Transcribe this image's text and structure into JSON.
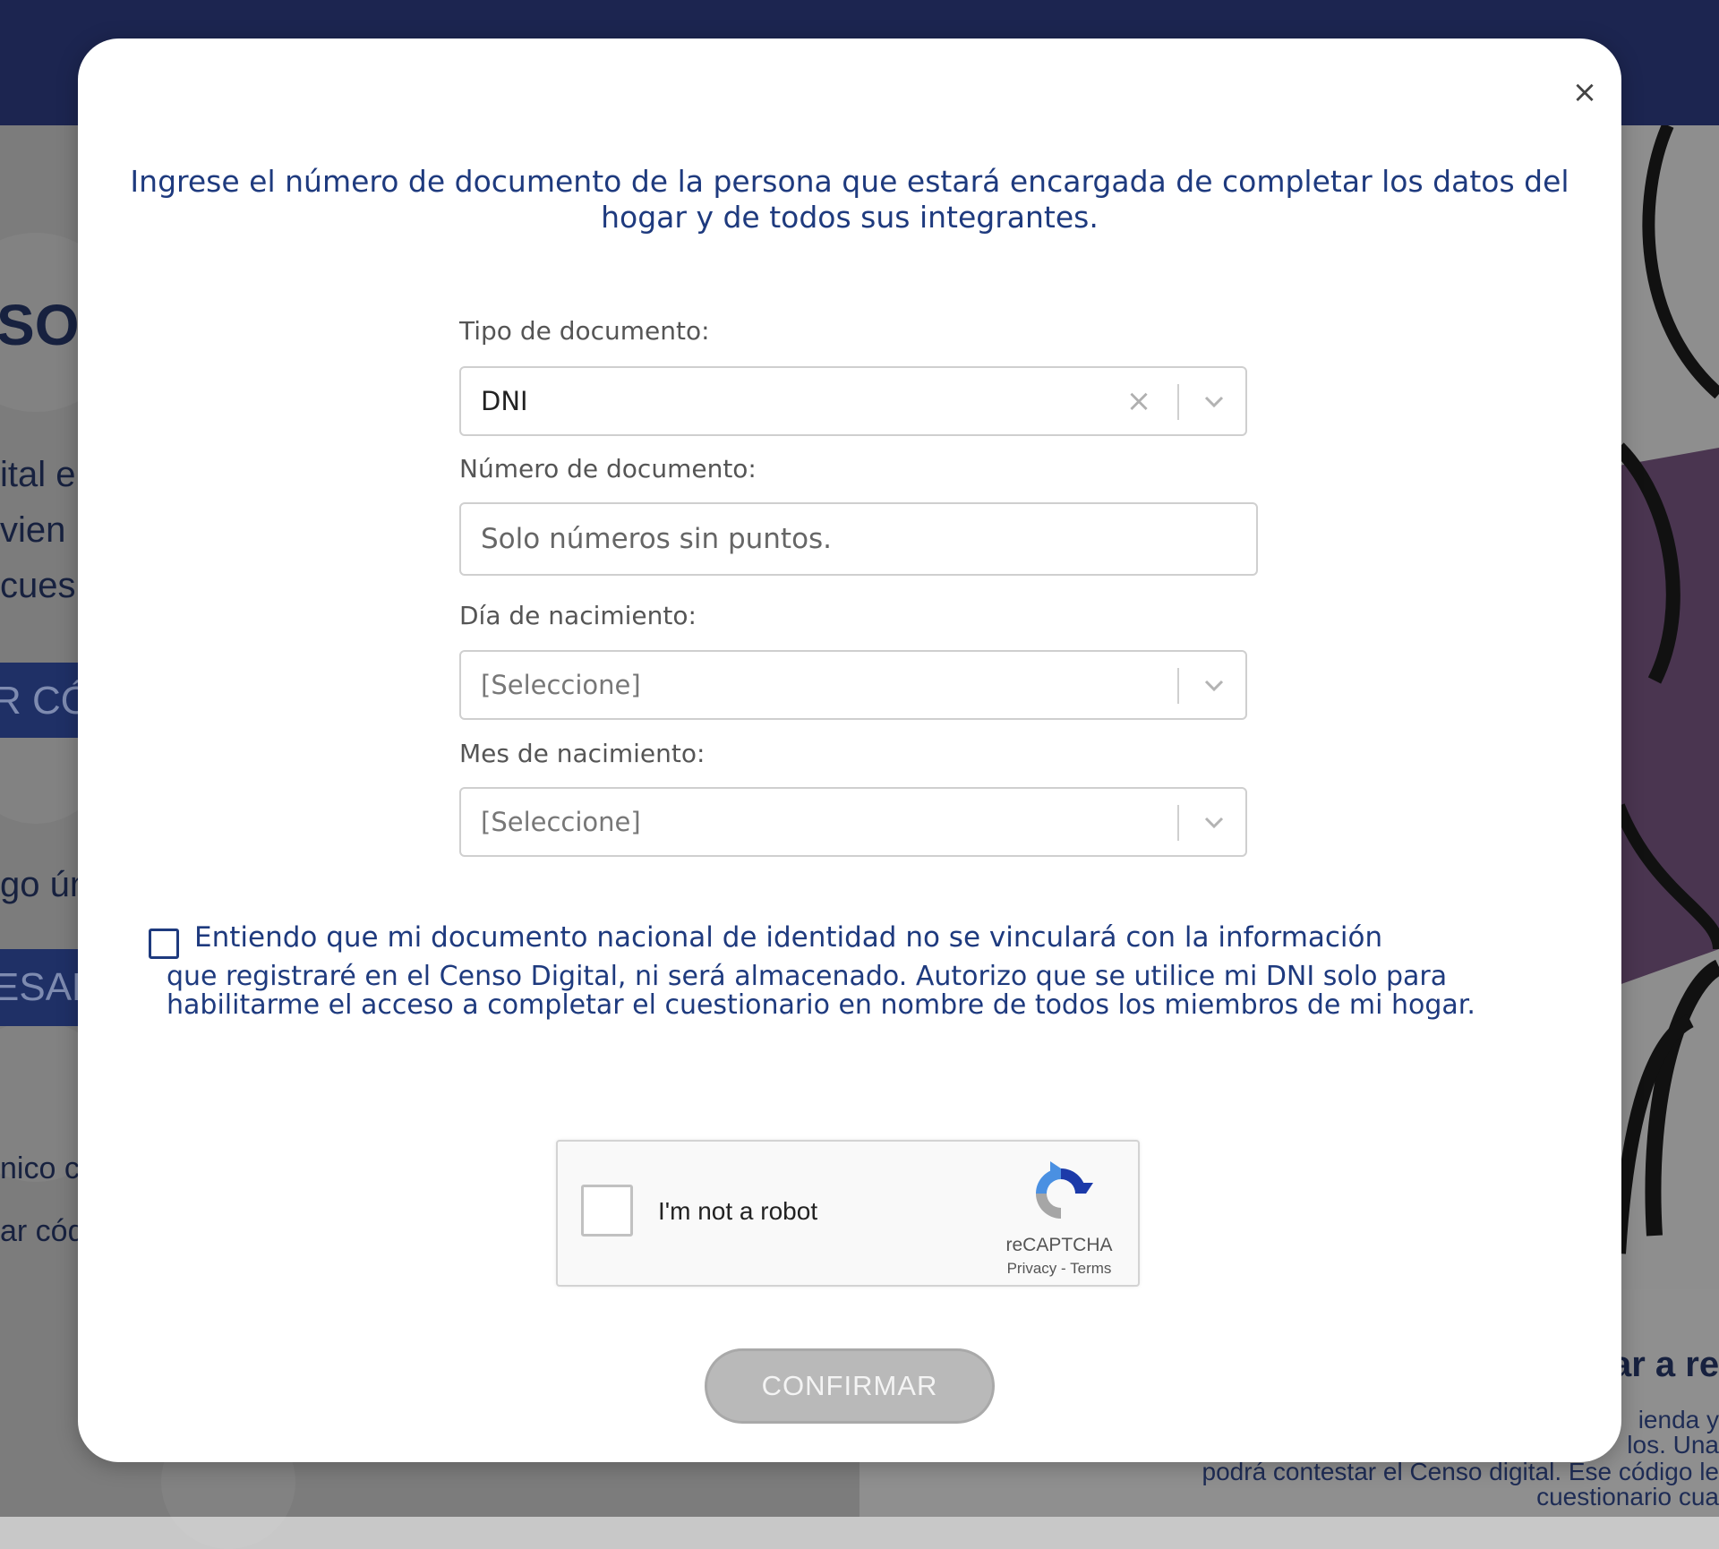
{
  "background": {
    "fragments": [
      "SO",
      "ital e",
      "vien",
      "cues",
      "R CÓD",
      "go ún",
      "ESAR",
      "nico c",
      "ar cód",
      "ar a re"
    ],
    "right_text": [
      "ienda y",
      "los. Una",
      "podrá contestar el Censo digital. Ese código le",
      "cuestionario cua"
    ]
  },
  "modal": {
    "close_label": "×",
    "intro": "Ingrese el número de documento de la persona que estará encargada de completar los datos del hogar y de todos sus integrantes.",
    "tipo_label": "Tipo de documento:",
    "tipo_value": "DNI",
    "numero_label": "Número de documento:",
    "numero_placeholder": "Solo números sin puntos.",
    "numero_value": "",
    "dia_label": "Día de nacimiento:",
    "dia_value": "[Seleccione]",
    "mes_label": "Mes de nacimiento:",
    "mes_value": "[Seleccione]",
    "consent_first_line": "Entiendo que mi documento nacional de identidad no se vinculará con la información",
    "consent_rest": "que registraré en el Censo Digital, ni será almacenado. Autorizo que se utilice mi DNI solo para habilitarme el acceso a completar el cuestionario en nombre de todos los miembros de mi hogar.",
    "consent_checked": false,
    "confirm_label": "CONFIRMAR"
  },
  "recaptcha": {
    "label": "I'm not a robot",
    "brand": "reCAPTCHA",
    "privacy": "Privacy",
    "separator": " - ",
    "terms": "Terms"
  }
}
